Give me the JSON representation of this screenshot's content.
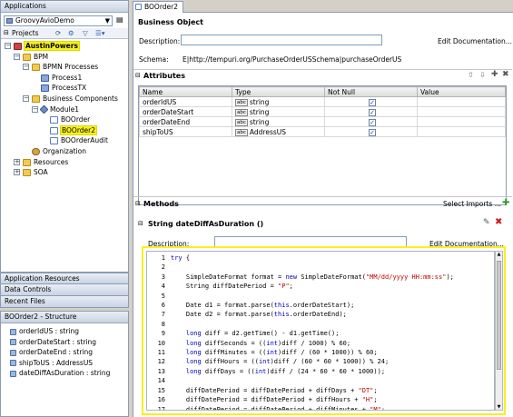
{
  "left": {
    "applications_title": "Applications",
    "app_selector": "GroovyAvioDemo",
    "projects_label": "Projects",
    "tree": [
      {
        "label": "AustinPowers",
        "level": 0,
        "icon": "project-icon",
        "expanded": true,
        "highlight": true
      },
      {
        "label": "BPM",
        "level": 1,
        "icon": "folder-icon",
        "expanded": true
      },
      {
        "label": "BPMN Processes",
        "level": 2,
        "icon": "folder-icon",
        "expanded": true
      },
      {
        "label": "Process1",
        "level": 3,
        "icon": "process-icon"
      },
      {
        "label": "ProcessTX",
        "level": 3,
        "icon": "process-icon"
      },
      {
        "label": "Business Components",
        "level": 2,
        "icon": "folder-icon",
        "expanded": true
      },
      {
        "label": "Module1",
        "level": 3,
        "icon": "module-icon",
        "expanded": true
      },
      {
        "label": "BOOrder",
        "level": 4,
        "icon": "business-object-icon"
      },
      {
        "label": "BOOrder2",
        "level": 4,
        "icon": "business-object-icon",
        "highlight": true
      },
      {
        "label": "BOOrderAudit",
        "level": 4,
        "icon": "business-object-icon"
      },
      {
        "label": "Organization",
        "level": 2,
        "icon": "organization-icon"
      },
      {
        "label": "Resources",
        "level": 1,
        "icon": "folder-icon",
        "collapsed": true
      },
      {
        "label": "SOA",
        "level": 1,
        "icon": "folder-icon",
        "collapsed": true
      }
    ],
    "accordion": [
      "Application Resources",
      "Data Controls",
      "Recent Files"
    ],
    "structure_title": "BOOrder2 - Structure",
    "structure_items": [
      "orderIdUS : string",
      "orderDateStart : string",
      "orderDateEnd : string",
      "shipToUS : AddressUS",
      "dateDiffAsDuration : string"
    ]
  },
  "editor": {
    "tab_label": "BOOrder2",
    "business_object_title": "Business Object",
    "description_label": "Description:",
    "edit_documentation": "Edit Documentation...",
    "schema_label": "Schema:",
    "schema_value": "E|http://tempuri.org/PurchaseOrderUSSchema|purchaseOrderUS",
    "attributes_title": "Attributes",
    "attr_columns": [
      "Name",
      "Type",
      "Not Null",
      "Value"
    ],
    "attributes": [
      {
        "name": "orderIdUS",
        "type": "string",
        "not_null": "✓",
        "value": ""
      },
      {
        "name": "orderDateStart",
        "type": "string",
        "not_null": "✓",
        "value": ""
      },
      {
        "name": "orderDateEnd",
        "type": "string",
        "not_null": "✓",
        "value": ""
      },
      {
        "name": "shipToUS",
        "type": "AddressUS",
        "not_null": "✓",
        "value": ""
      }
    ],
    "methods_title": "Methods",
    "select_imports": "Select Imports ...",
    "method_signature": "String dateDiffAsDuration ()",
    "method_description_label": "Description:",
    "method_edit_documentation": "Edit Documentation...",
    "code_lines": [
      {
        "n": "1",
        "parts": [
          [
            "kw",
            "try"
          ],
          [
            "",
            " {"
          ]
        ]
      },
      {
        "n": "2",
        "parts": [
          [
            "",
            ""
          ]
        ]
      },
      {
        "n": "3",
        "parts": [
          [
            "",
            "    SimpleDateFormat format = "
          ],
          [
            "kw",
            "new"
          ],
          [
            "",
            " SimpleDateFormat("
          ],
          [
            "str",
            "\"MM/dd/yyyy HH:mm:ss\""
          ],
          [
            "",
            ");"
          ]
        ]
      },
      {
        "n": "4",
        "parts": [
          [
            "",
            "    String diffDatePeriod = "
          ],
          [
            "str",
            "\"P\""
          ],
          [
            "",
            ";"
          ]
        ]
      },
      {
        "n": "5",
        "parts": [
          [
            "",
            ""
          ]
        ]
      },
      {
        "n": "6",
        "parts": [
          [
            "",
            "    Date d1 = format.parse("
          ],
          [
            "kw",
            "this"
          ],
          [
            "",
            ".orderDateStart);"
          ]
        ]
      },
      {
        "n": "7",
        "parts": [
          [
            "",
            "    Date d2 = format.parse("
          ],
          [
            "kw",
            "this"
          ],
          [
            "",
            ".orderDateEnd);"
          ]
        ]
      },
      {
        "n": "8",
        "parts": [
          [
            "",
            ""
          ]
        ]
      },
      {
        "n": "9",
        "parts": [
          [
            "kw",
            "    long"
          ],
          [
            "",
            " diff = d2.getTime() - d1.getTime();"
          ]
        ]
      },
      {
        "n": "10",
        "parts": [
          [
            "kw",
            "    long"
          ],
          [
            "",
            " diffSeconds = (("
          ],
          [
            "kw",
            "int"
          ],
          [
            "",
            ")diff / 1000) % 60;"
          ]
        ]
      },
      {
        "n": "11",
        "parts": [
          [
            "kw",
            "    long"
          ],
          [
            "",
            " diffMinutes = (("
          ],
          [
            "kw",
            "int"
          ],
          [
            "",
            ")diff / (60 * 1000)) % 60;"
          ]
        ]
      },
      {
        "n": "12",
        "parts": [
          [
            "kw",
            "    long"
          ],
          [
            "",
            " diffHours = (("
          ],
          [
            "kw",
            "int"
          ],
          [
            "",
            ")diff / (60 * 60 * 1000)) % 24;"
          ]
        ]
      },
      {
        "n": "13",
        "parts": [
          [
            "kw",
            "    long"
          ],
          [
            "",
            " diffDays = (("
          ],
          [
            "kw",
            "int"
          ],
          [
            "",
            ")diff / (24 * 60 * 60 * 1000));"
          ]
        ]
      },
      {
        "n": "14",
        "parts": [
          [
            "",
            ""
          ]
        ]
      },
      {
        "n": "15",
        "parts": [
          [
            "",
            "    diffDatePeriod = diffDatePeriod + diffDays + "
          ],
          [
            "str",
            "\"DT\""
          ],
          [
            "",
            ";"
          ]
        ]
      },
      {
        "n": "16",
        "parts": [
          [
            "",
            "    diffDatePeriod = diffDatePeriod + diffHours + "
          ],
          [
            "str",
            "\"H\""
          ],
          [
            "",
            ";"
          ]
        ]
      },
      {
        "n": "17",
        "parts": [
          [
            "",
            "    diffDatePeriod = diffDatePeriod + diffMinutes + "
          ],
          [
            "str",
            "\"M\""
          ],
          [
            "",
            ";"
          ]
        ]
      }
    ]
  },
  "colors": {
    "highlight_yellow": "#f7f21a",
    "keyword_blue": "#0000c0",
    "string_red": "#c00000",
    "panel_border": "#8c9bb2"
  }
}
